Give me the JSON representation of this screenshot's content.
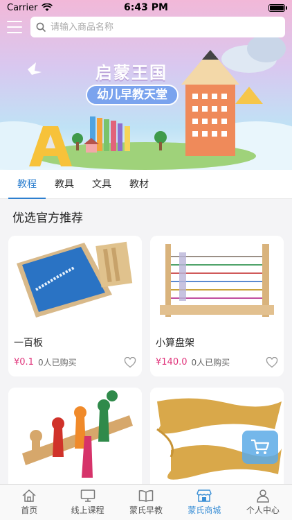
{
  "status_bar": {
    "carrier": "Carrier",
    "time": "6:43 PM"
  },
  "search": {
    "placeholder": "请输入商品名称"
  },
  "banner": {
    "title": "启蒙王国",
    "subtitle": "幼儿早教天堂"
  },
  "tabs": [
    {
      "label": "教程",
      "active": true
    },
    {
      "label": "教具",
      "active": false
    },
    {
      "label": "文具",
      "active": false
    },
    {
      "label": "教材",
      "active": false
    }
  ],
  "section_title": "优选官方推荐",
  "products": [
    {
      "name": "一百板",
      "price": "¥0.1",
      "sold": "0人已购买"
    },
    {
      "name": "小算盘架",
      "price": "¥140.0",
      "sold": "0人已购买"
    },
    {
      "name": "",
      "price": "",
      "sold": ""
    },
    {
      "name": "",
      "price": "",
      "sold": ""
    }
  ],
  "tabbar": [
    {
      "label": "首页",
      "icon": "home-icon"
    },
    {
      "label": "线上课程",
      "icon": "monitor-icon"
    },
    {
      "label": "蒙氏早教",
      "icon": "book-icon"
    },
    {
      "label": "蒙氏商城",
      "icon": "shop-icon",
      "active": true
    },
    {
      "label": "个人中心",
      "icon": "user-icon"
    }
  ],
  "colors": {
    "accent": "#2d7fcf",
    "price": "#e0327a",
    "tabbar_active": "#3a8fd6"
  }
}
